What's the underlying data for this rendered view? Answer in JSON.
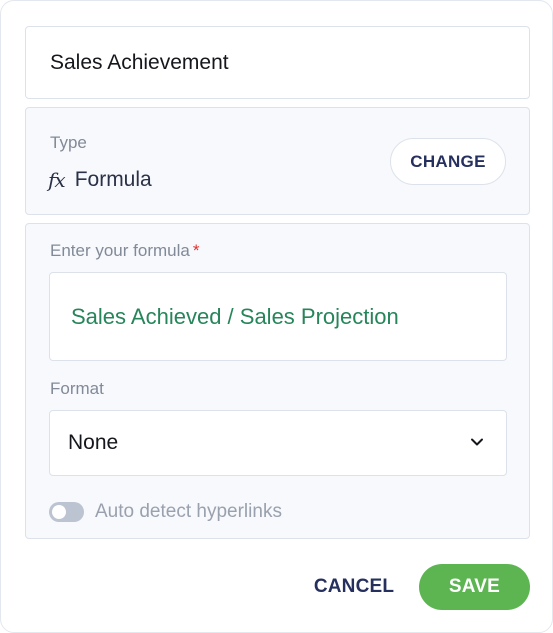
{
  "field": {
    "name": "Sales Achievement"
  },
  "type_section": {
    "label": "Type",
    "icon": "fx-icon",
    "icon_glyph": "fx",
    "value": "Formula",
    "change_label": "CHANGE"
  },
  "formula_section": {
    "label": "Enter your formula",
    "required_marker": "*",
    "formula": "Sales Achieved / Sales Projection"
  },
  "format_section": {
    "label": "Format",
    "selected": "None"
  },
  "hyperlink_toggle": {
    "label": "Auto detect hyperlinks",
    "enabled": false
  },
  "footer": {
    "cancel_label": "CANCEL",
    "save_label": "SAVE"
  },
  "colors": {
    "formula_text": "#27855a",
    "save_button": "#5db552",
    "primary_text": "#26305e",
    "required": "#e03131"
  }
}
